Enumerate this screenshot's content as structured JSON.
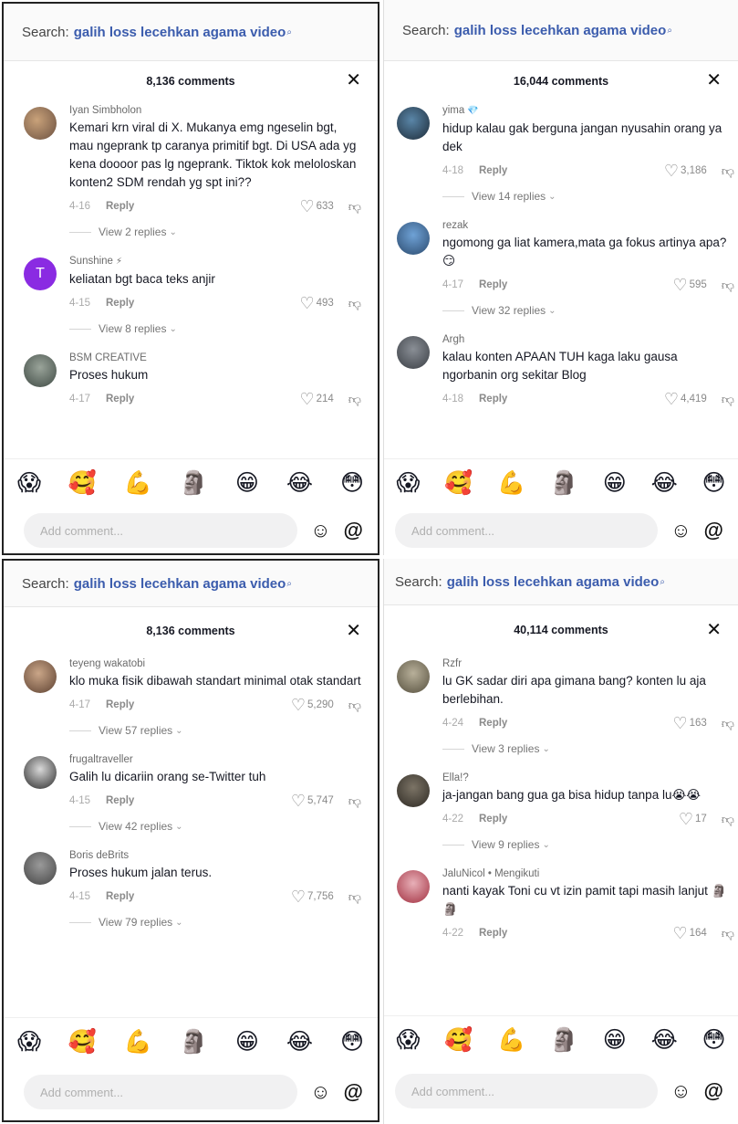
{
  "search": {
    "prefix": "Search:",
    "query": "galih loss lecehkan agama video",
    "mag_glyph": "⌕"
  },
  "close_glyph": "✕",
  "emojis": [
    "😱",
    "🥰",
    "💪",
    "🗿",
    "😁",
    "😂",
    "😳"
  ],
  "input_placeholder": "Add comment...",
  "colors": {
    "query": "#3b5cad",
    "accent_purple": "#8a2be2"
  },
  "panels": [
    {
      "count_title": "8,136 comments",
      "comments": [
        {
          "user": "Iyan Simbholon",
          "text": "Kemari krn viral di X. Mukanya emg ngeselin bgt, mau ngeprank tp caranya primitif bgt. Di USA ada yg kena doooor pas lg ngeprank. Tiktok kok meloloskan konten2 SDM rendah yg spt ini??",
          "date": "4-16",
          "reply": "Reply",
          "likes": "633",
          "replies": "View 2 replies"
        },
        {
          "user": "Sunshine",
          "badge": "⚡",
          "text": "keliatan bgt baca teks anjir",
          "date": "4-15",
          "reply": "Reply",
          "likes": "493",
          "replies": "View 8 replies",
          "avatar_letter": "T"
        },
        {
          "user": "BSM CREATIVE",
          "text": "Proses hukum",
          "date": "4-17",
          "reply": "Reply",
          "likes": "214"
        }
      ]
    },
    {
      "count_title": "16,044 comments",
      "comments": [
        {
          "user": "yima",
          "badge": "💎",
          "text": "hidup kalau gak berguna jangan nyusahin orang ya dek",
          "date": "4-18",
          "reply": "Reply",
          "likes": "3,186",
          "replies": "View 14 replies"
        },
        {
          "user": "rezak",
          "text": "ngomong ga liat kamera,mata ga fokus artinya apa?😏",
          "date": "4-17",
          "reply": "Reply",
          "likes": "595",
          "replies": "View 32 replies"
        },
        {
          "user": "Argh",
          "text": "kalau konten APAAN TUH kaga laku gausa ngorbanin org sekitar Blog",
          "date": "4-18",
          "reply": "Reply",
          "likes": "4,419"
        }
      ]
    },
    {
      "count_title": "8,136 comments",
      "comments": [
        {
          "user": "teyeng wakatobi",
          "text": "klo muka fisik dibawah standart minimal otak standart",
          "date": "4-17",
          "reply": "Reply",
          "likes": "5,290",
          "replies": "View 57 replies"
        },
        {
          "user": "frugaltraveller",
          "text": "Galih lu dicariin orang se-Twitter tuh",
          "date": "4-15",
          "reply": "Reply",
          "likes": "5,747",
          "replies": "View 42 replies"
        },
        {
          "user": "Boris deBrits",
          "text": "Proses hukum jalan terus.",
          "date": "4-15",
          "reply": "Reply",
          "likes": "7,756",
          "replies": "View 79 replies"
        }
      ]
    },
    {
      "count_title": "40,114 comments",
      "comments": [
        {
          "user": "Rzfr",
          "text": "lu GK sadar diri apa gimana bang? konten lu aja berlebihan.",
          "date": "4-24",
          "reply": "Reply",
          "likes": "163",
          "replies": "View 3 replies"
        },
        {
          "user": "Ella!?",
          "text": "ja-jangan bang gua ga bisa hidup tanpa lu😭😭",
          "date": "4-22",
          "reply": "Reply",
          "likes": "17",
          "replies": "View 9 replies"
        },
        {
          "user": "JaluNicol • Mengikuti",
          "text": "nanti kayak Toni cu vt izin pamit tapi masih lanjut 🗿🗿",
          "date": "4-22",
          "reply": "Reply",
          "likes": "164"
        }
      ]
    }
  ]
}
